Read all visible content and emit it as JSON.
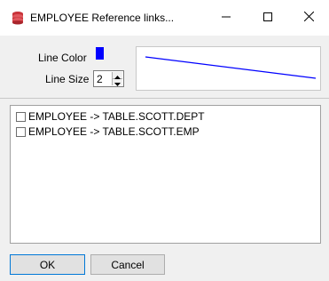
{
  "window": {
    "title": "EMPLOYEE Reference links...",
    "icon": "database-stack-icon",
    "controls": {
      "minimize": "minimize-icon",
      "maximize": "maximize-icon",
      "close": "close-icon"
    }
  },
  "settings": {
    "line_color_label": "Line Color",
    "line_color": "#0000ff",
    "line_size_label": "Line Size",
    "line_size_value": "2"
  },
  "links": [
    {
      "label": "EMPLOYEE -> TABLE.SCOTT.DEPT",
      "checked": false
    },
    {
      "label": "EMPLOYEE -> TABLE.SCOTT.EMP",
      "checked": false
    }
  ],
  "buttons": {
    "ok_label": "OK",
    "cancel_label": "Cancel"
  },
  "colors": {
    "accent": "#0078d7",
    "line": "#0000ff",
    "dialog_bg": "#f0f0f0"
  }
}
